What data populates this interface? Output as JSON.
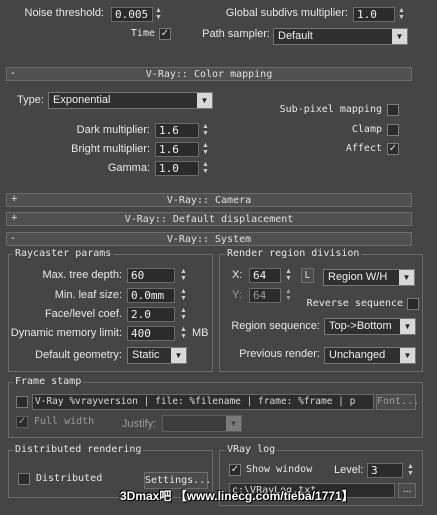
{
  "top": {
    "noise_threshold_label": "Noise threshold:",
    "noise_threshold_value": "0.005",
    "global_subdivs_label": "Global subdivs multiplier:",
    "global_subdivs_value": "1.0",
    "time_label": "Time",
    "time_checked": "✓",
    "path_sampler_label": "Path sampler:",
    "path_sampler_value": "Default"
  },
  "color_mapping": {
    "rollout_sign": "-",
    "rollout_title": "V-Ray:: Color mapping",
    "type_label": "Type:",
    "type_value": "Exponential",
    "subpixel_label": "Sub-pixel mapping",
    "clamp_label": "Clamp",
    "affect_label": "Affect",
    "affect_checked": "✓",
    "dark_label": "Dark multiplier:",
    "dark_value": "1.6",
    "bright_label": "Bright multiplier:",
    "bright_value": "1.6",
    "gamma_label": "Gamma:",
    "gamma_value": "1.0"
  },
  "camera": {
    "sign": "+",
    "title": "V-Ray:: Camera"
  },
  "displacement": {
    "sign": "+",
    "title": "V-Ray:: Default displacement"
  },
  "system": {
    "sign": "-",
    "title": "V-Ray:: System",
    "raycaster": {
      "title": "Raycaster params",
      "max_tree_depth_label": "Max. tree depth:",
      "max_tree_depth_value": "60",
      "min_leaf_label": "Min. leaf size:",
      "min_leaf_value": "0.0mm",
      "face_level_label": "Face/level coef.",
      "face_level_value": "2.0",
      "dyn_mem_label": "Dynamic memory limit:",
      "dyn_mem_value": "400",
      "dyn_mem_unit": "MB",
      "default_geom_label": "Default geometry:",
      "default_geom_value": "Static"
    },
    "region": {
      "title": "Render region division",
      "x_label": "X:",
      "x_value": "64",
      "y_label": "Y:",
      "y_value": "64",
      "lock_label": "L",
      "region_mode": "Region W/H",
      "reverse_label": "Reverse sequence",
      "sequence_label": "Region sequence:",
      "sequence_value": "Top->Bottom",
      "previous_label": "Previous render:",
      "previous_value": "Unchanged"
    },
    "frame_stamp": {
      "title": "Frame stamp",
      "stamp_text": "V-Ray %vrayversion | file: %filename | frame: %frame | p",
      "font_button": "Font...",
      "full_width_label": "Full width",
      "justify_label": "Justify:"
    },
    "distributed": {
      "title": "Distributed rendering",
      "dist_label": "Distributed",
      "settings_button": "Settings..."
    },
    "vray_log": {
      "title": "VRay log",
      "show_window_label": "Show window",
      "show_window_checked": "✓",
      "level_label": "Level:",
      "level_value": "3",
      "log_path": "c:\\VRayLog.txt"
    }
  },
  "watermark": "3Dmax吧 【www.linecg.com/tieba/1771】"
}
